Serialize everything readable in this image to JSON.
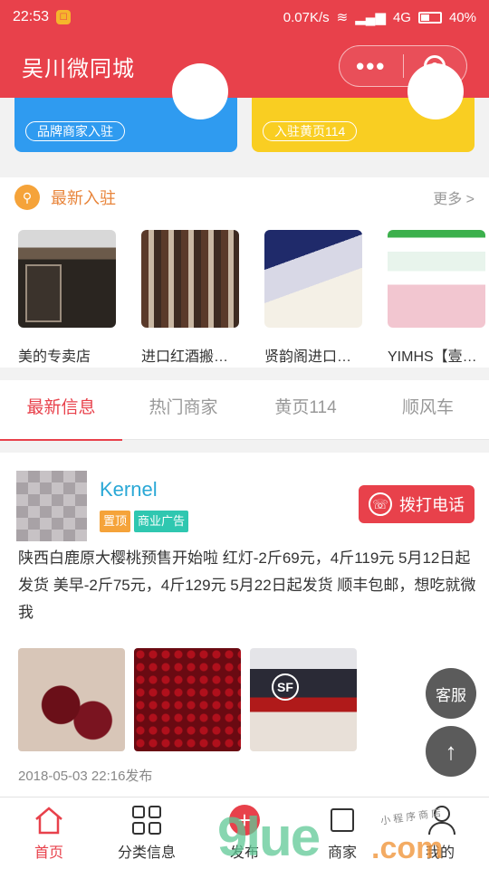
{
  "status_bar": {
    "time": "22:53",
    "network_speed": "0.07K/s",
    "network_type": "4G",
    "battery": "40%"
  },
  "nav": {
    "title": "吴川微同城",
    "menu_icon": "more-dots-icon",
    "close_icon": "target-circle-icon"
  },
  "cards": [
    {
      "label": "品牌商家入驻",
      "color": "#2f9bf0"
    },
    {
      "label": "入驻黄页114",
      "color": "#f9ce22"
    }
  ],
  "new_section": {
    "title": "最新入驻",
    "more": "更多 >",
    "items": [
      {
        "name": "美的专卖店"
      },
      {
        "name": "进口红酒搬…"
      },
      {
        "name": "贤韵阁进口…"
      },
      {
        "name": "YIMHS【壹…"
      }
    ]
  },
  "tabs": [
    {
      "label": "最新信息",
      "active": true
    },
    {
      "label": "热门商家",
      "active": false
    },
    {
      "label": "黄页114",
      "active": false
    },
    {
      "label": "顺风车",
      "active": false
    }
  ],
  "post": {
    "username": "Kernel",
    "tags": [
      "置顶",
      "商业广告"
    ],
    "call_button": "拨打电话",
    "text": "陕西白鹿原大樱桃预售开始啦 红灯-2斤69元，4斤119元 5月12日起发货 美早-2斤75元，4斤129元 5月22日起发货 顺丰包邮，想吃就微我",
    "date": "2018-05-03 22:16发布"
  },
  "float_buttons": {
    "service": "客服",
    "top_icon": "arrow-up-icon"
  },
  "tabbar": [
    {
      "label": "首页",
      "icon": "home-icon",
      "active": true
    },
    {
      "label": "分类信息",
      "icon": "grid-icon",
      "active": false
    },
    {
      "label": "发布",
      "icon": "plus-icon",
      "active": false
    },
    {
      "label": "商家",
      "icon": "shop-icon",
      "active": false
    },
    {
      "label": "我的",
      "icon": "person-icon",
      "active": false
    }
  ],
  "watermark": {
    "text_main": "9lue",
    "text_com": ".com",
    "text_small": "小 程 序 商 店"
  },
  "colors": {
    "brand": "#e8414b",
    "link": "#2aa8d6",
    "accent_orange": "#f5a33a",
    "accent_teal": "#2fc7b0"
  }
}
